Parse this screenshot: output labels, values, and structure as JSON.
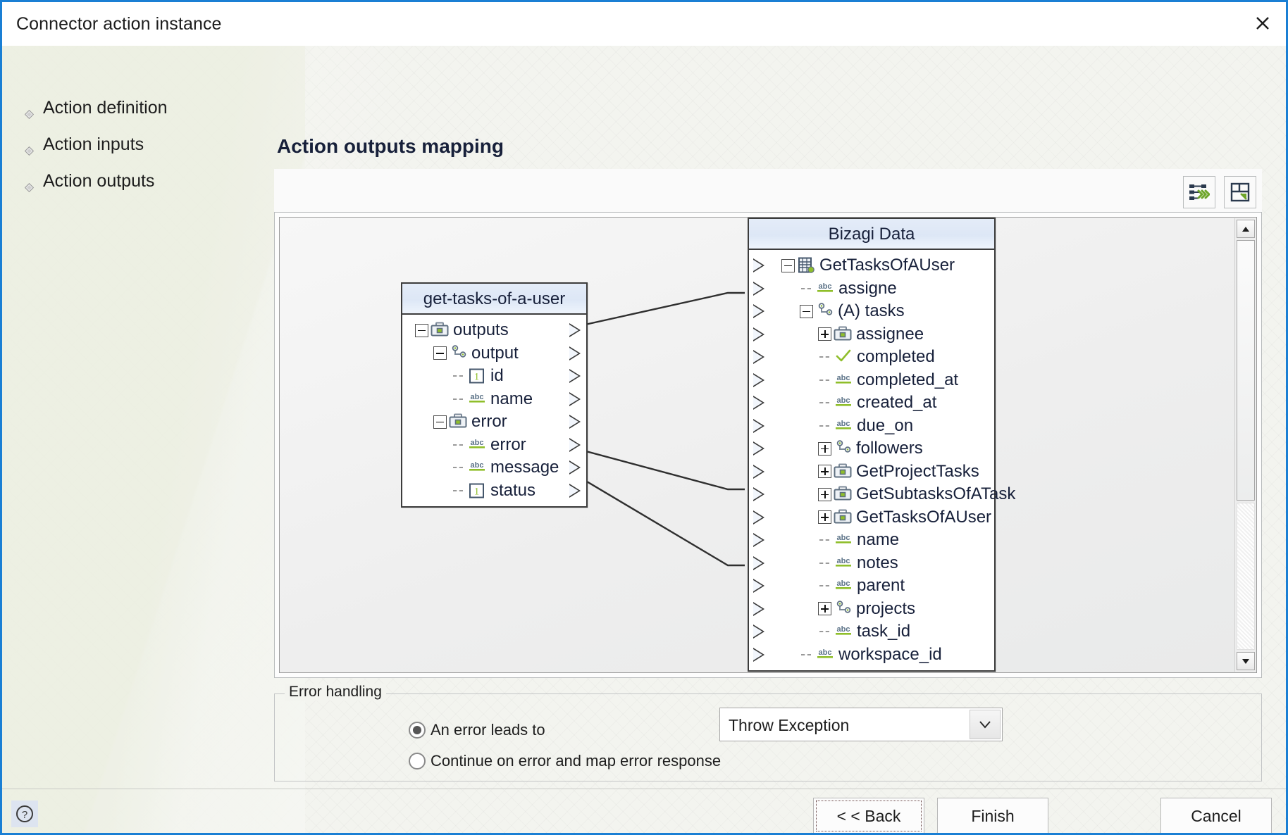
{
  "window": {
    "title": "Connector action instance",
    "close_icon": "close-icon",
    "accent": "#1a7fd4"
  },
  "nav": {
    "items": [
      {
        "label": "Action definition",
        "icon": "diamond-bullet-icon"
      },
      {
        "label": "Action inputs",
        "icon": "diamond-bullet-icon"
      },
      {
        "label": "Action outputs",
        "icon": "diamond-bullet-icon"
      }
    ]
  },
  "main": {
    "title": "Action outputs mapping",
    "toolbar": {
      "automap_icon": "auto-map-icon",
      "layout_icon": "expand-layout-icon"
    }
  },
  "source_panel": {
    "title": "get-tasks-of-a-user",
    "rows": [
      {
        "label": "outputs",
        "icon": "briefcase-icon",
        "expander": "minus",
        "depth": 0,
        "connector": "triangle-right"
      },
      {
        "label": "output",
        "icon": "collection-icon",
        "expander": "minus",
        "depth": 1,
        "connector": "triangle-right"
      },
      {
        "label": "id",
        "icon": "number-icon",
        "expander": "none",
        "depth": 2,
        "connector": "triangle-right"
      },
      {
        "label": "name",
        "icon": "abc-icon",
        "expander": "none",
        "depth": 2,
        "connector": "triangle-right"
      },
      {
        "label": "error",
        "icon": "briefcase-icon",
        "expander": "minus",
        "depth": 1,
        "connector": "triangle-right"
      },
      {
        "label": "error",
        "icon": "abc-icon",
        "expander": "none",
        "depth": 2,
        "connector": "triangle-right"
      },
      {
        "label": "message",
        "icon": "abc-icon",
        "expander": "none",
        "depth": 2,
        "connector": "triangle-right"
      },
      {
        "label": "status",
        "icon": "number-icon",
        "expander": "none",
        "depth": 2,
        "connector": "triangle-right"
      }
    ]
  },
  "target_panel": {
    "title": "Bizagi Data",
    "rows": [
      {
        "label": "GetTasksOfAUser",
        "icon": "entity-icon",
        "expander": "minus",
        "depth": 0,
        "connector": "triangle-right"
      },
      {
        "label": "assigne",
        "icon": "abc-icon",
        "expander": "none",
        "depth": 1,
        "connector": "triangle-right"
      },
      {
        "label": "(A) tasks",
        "icon": "collection-icon",
        "expander": "minus",
        "depth": 1,
        "connector": "triangle-right"
      },
      {
        "label": "assignee",
        "icon": "briefcase-icon",
        "expander": "plus",
        "depth": 2,
        "connector": "triangle-right"
      },
      {
        "label": "completed",
        "icon": "check-icon",
        "expander": "none",
        "depth": 2,
        "connector": "triangle-right"
      },
      {
        "label": "completed_at",
        "icon": "abc-icon",
        "expander": "none",
        "depth": 2,
        "connector": "triangle-right"
      },
      {
        "label": "created_at",
        "icon": "abc-icon",
        "expander": "none",
        "depth": 2,
        "connector": "triangle-right"
      },
      {
        "label": "due_on",
        "icon": "abc-icon",
        "expander": "none",
        "depth": 2,
        "connector": "triangle-right"
      },
      {
        "label": "followers",
        "icon": "collection-icon",
        "expander": "plus",
        "depth": 2,
        "connector": "triangle-right"
      },
      {
        "label": "GetProjectTasks",
        "icon": "briefcase-icon",
        "expander": "plus",
        "depth": 2,
        "connector": "triangle-right"
      },
      {
        "label": "GetSubtasksOfATask",
        "icon": "briefcase-icon",
        "expander": "plus",
        "depth": 2,
        "connector": "triangle-right"
      },
      {
        "label": "GetTasksOfAUser",
        "icon": "briefcase-icon",
        "expander": "plus",
        "depth": 2,
        "connector": "triangle-right"
      },
      {
        "label": "name",
        "icon": "abc-icon",
        "expander": "none",
        "depth": 2,
        "connector": "triangle-right"
      },
      {
        "label": "notes",
        "icon": "abc-icon",
        "expander": "none",
        "depth": 2,
        "connector": "triangle-right"
      },
      {
        "label": "parent",
        "icon": "abc-icon",
        "expander": "none",
        "depth": 2,
        "connector": "triangle-right"
      },
      {
        "label": "projects",
        "icon": "collection-icon",
        "expander": "plus",
        "depth": 2,
        "connector": "triangle-right"
      },
      {
        "label": "task_id",
        "icon": "abc-icon",
        "expander": "none",
        "depth": 2,
        "connector": "triangle-right"
      },
      {
        "label": "workspace_id",
        "icon": "abc-icon",
        "expander": "none",
        "depth": 1,
        "connector": "triangle-right"
      }
    ]
  },
  "mappings": [
    {
      "from": "output",
      "to": "(A) tasks"
    },
    {
      "from": "id",
      "to": "task_id"
    },
    {
      "from": "name",
      "to": "name"
    }
  ],
  "scrollbar": {
    "up_icon": "scroll-up-icon",
    "down_icon": "scroll-down-icon"
  },
  "error_handling": {
    "legend": "Error handling",
    "options": [
      {
        "label": "An error leads to",
        "checked": true
      },
      {
        "label": "Continue on error and map error response",
        "checked": false
      }
    ],
    "select": {
      "value": "Throw Exception",
      "icon": "chevron-down-icon"
    }
  },
  "footer": {
    "help_icon": "help-icon",
    "buttons": [
      {
        "label": "< < Back",
        "focused": true
      },
      {
        "label": "Finish",
        "focused": false
      },
      {
        "label": "Cancel",
        "focused": false
      }
    ]
  }
}
